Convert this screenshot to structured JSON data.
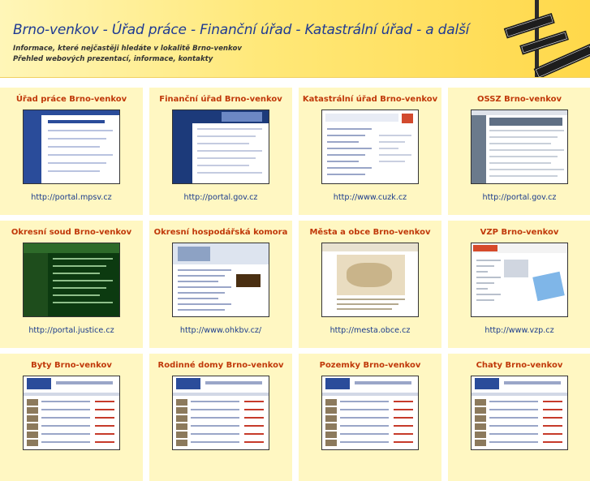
{
  "header": {
    "title": "Brno-venkov - Úřad práce - Finanční úřad - Katastrální úřad - a další",
    "subtitle1": "Informace, které nejčastěji hledáte v lokalitě Brno-venkov",
    "subtitle2": "Přehled webových prezentací, informace, kontakty"
  },
  "colors": {
    "header_bg": "#ffe878",
    "cell_bg": "#fff7c2",
    "title_color": "#c0390a",
    "url_color": "#1a3b8c",
    "site_title_color": "#1f3a93"
  },
  "cards": [
    {
      "title": "Úřad práce Brno-venkov",
      "url": "http://portal.mpsv.cz",
      "thumb": "mpsv"
    },
    {
      "title": "Finanční úřad Brno-venkov",
      "url": "http://portal.gov.cz",
      "thumb": "gov"
    },
    {
      "title": "Katastrální úřad Brno-venkov",
      "url": "http://www.cuzk.cz",
      "thumb": "cuzk"
    },
    {
      "title": "OSSZ Brno-venkov",
      "url": "http://portal.gov.cz",
      "thumb": "ossz"
    },
    {
      "title": "Okresní soud Brno-venkov",
      "url": "http://portal.justice.cz",
      "thumb": "justice"
    },
    {
      "title": "Okresní hospodářská komora",
      "url": "http://www.ohkbv.cz/",
      "thumb": "ohk"
    },
    {
      "title": "Města a obce Brno-venkov",
      "url": "http://mesta.obce.cz",
      "thumb": "obce"
    },
    {
      "title": "VZP Brno-venkov",
      "url": "http://www.vzp.cz",
      "thumb": "vzp"
    },
    {
      "title": "Byty Brno-venkov",
      "url": "",
      "thumb": "reality"
    },
    {
      "title": "Rodinné domy Brno-venkov",
      "url": "",
      "thumb": "reality"
    },
    {
      "title": "Pozemky Brno-venkov",
      "url": "",
      "thumb": "reality"
    },
    {
      "title": "Chaty Brno-venkov",
      "url": "",
      "thumb": "reality"
    }
  ]
}
